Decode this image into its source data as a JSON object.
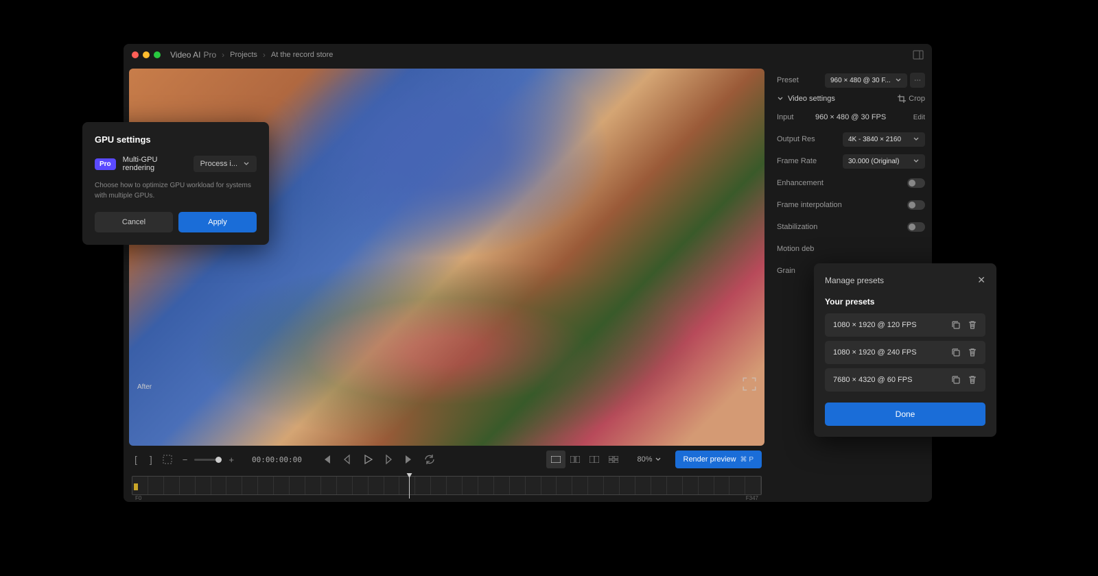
{
  "app": {
    "name": "Video AI",
    "tier": "Pro"
  },
  "breadcrumbs": [
    "Projects",
    "At the record store"
  ],
  "preview": {
    "after_label": "After"
  },
  "controls": {
    "timecode": "00:00:00:00",
    "zoom_pct": "80%",
    "render_label": "Render preview",
    "render_shortcut": "⌘ P"
  },
  "timeline": {
    "start_label": "F0",
    "end_label": "F347"
  },
  "sidebar": {
    "preset_label": "Preset",
    "preset_value": "960 × 480 @ 30 F...",
    "video_settings_label": "Video settings",
    "crop_label": "Crop",
    "input_label": "Input",
    "input_value": "960 × 480 @ 30 FPS",
    "edit_label": "Edit",
    "output_label": "Output Res",
    "output_value": "4K - 3840 × 2160",
    "framerate_label": "Frame Rate",
    "framerate_value": "30.000 (Original)",
    "enhancement_label": "Enhancement",
    "interp_label": "Frame interpolation",
    "stab_label": "Stabilization",
    "motion_label": "Motion deb",
    "grain_label": "Grain"
  },
  "gpu_modal": {
    "title": "GPU settings",
    "badge": "Pro",
    "label": "Multi-GPU rendering",
    "select": "Process i...",
    "desc": "Choose how to optimize GPU workload for systems with multiple GPUs.",
    "cancel": "Cancel",
    "apply": "Apply"
  },
  "presets_modal": {
    "title": "Manage presets",
    "subtitle": "Your presets",
    "items": [
      "1080 × 1920 @ 120 FPS",
      "1080 × 1920 @ 240 FPS",
      "7680 × 4320 @ 60 FPS"
    ],
    "done": "Done"
  }
}
